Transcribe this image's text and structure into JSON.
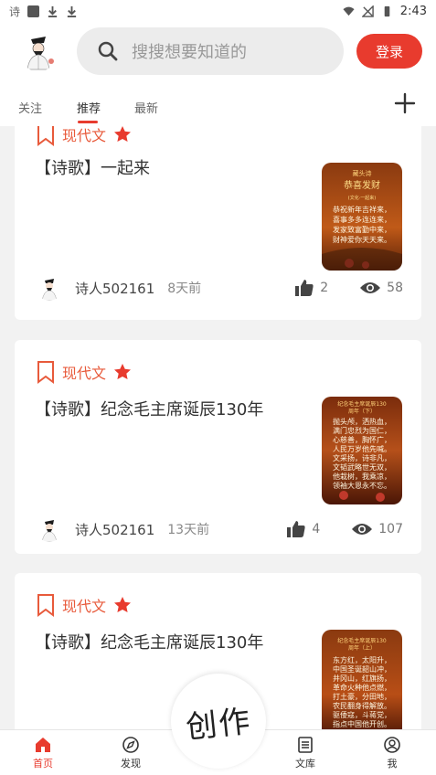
{
  "statusbar": {
    "left_char": "诗",
    "time": "2:43"
  },
  "header": {
    "search_placeholder": "搜搜想要知道的",
    "login_label": "登录"
  },
  "tabs": [
    {
      "label": "关注",
      "active": false
    },
    {
      "label": "推荐",
      "active": true
    },
    {
      "label": "最新",
      "active": false
    }
  ],
  "feed": [
    {
      "category": "现代文",
      "title": "【诗歌】一起来",
      "author": "诗人502161",
      "time": "8天前",
      "likes": "2",
      "views": "58",
      "thumb": {
        "lines": [
          "藏头诗",
          "恭喜发财",
          "(文化·一起来)",
          "恭祝新年吉祥来，",
          "喜事多多连连来，",
          "发家致富勤中来，",
          "财神爱你天天来。"
        ]
      }
    },
    {
      "category": "现代文",
      "title": "【诗歌】纪念毛主席诞辰130年",
      "author": "诗人502161",
      "time": "13天前",
      "likes": "4",
      "views": "107",
      "thumb": {
        "lines": [
          "纪念毛主席诞辰130",
          "周年（下）",
          "抛头颅，洒热血，",
          "满门忠烈为国仁，",
          "心慈善，胸怀广，",
          "人民万岁他先喊。",
          "文采扬，诗非凡，",
          "文韬武略世无双，",
          "他栽树，我乘凉，",
          "领袖大恩永不忘。"
        ]
      }
    },
    {
      "category": "现代文",
      "title": "【诗歌】纪念毛主席诞辰130年",
      "thumb": {
        "lines": [
          "纪念毛主席诞辰130",
          "周年（上）",
          "东方红，太阳升，",
          "中国圣诞韶山冲，",
          "井冈山，红旗扬，",
          "革命火种他点燃，",
          "打土豪，分田地，",
          "农民翻身得解放。",
          "驱倭寇，斗蒋党，",
          "指点中国他开创。"
        ]
      }
    }
  ],
  "create_button": {
    "label": "创作"
  },
  "bottom_nav": [
    {
      "label": "首页",
      "icon": "home-icon",
      "active": true
    },
    {
      "label": "发现",
      "icon": "compass-icon",
      "active": false
    },
    {
      "label": "文库",
      "icon": "library-icon",
      "active": false
    },
    {
      "label": "我",
      "icon": "profile-icon",
      "active": false
    }
  ],
  "colors": {
    "accent": "#e83b2e",
    "category": "#e85a3b"
  }
}
